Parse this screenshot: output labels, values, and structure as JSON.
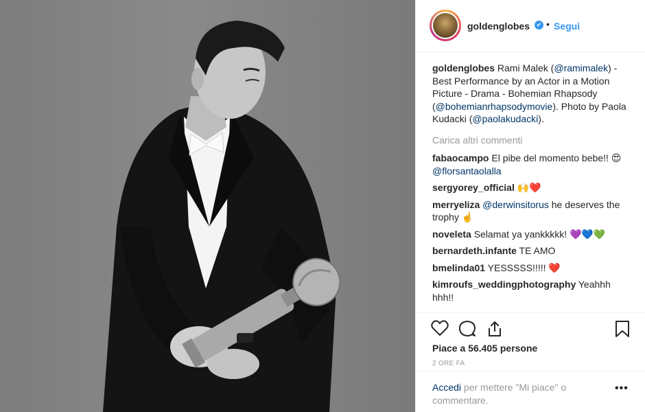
{
  "post": {
    "username": "goldenglobes",
    "verified_badge": "✔",
    "separator": "•",
    "follow_label": "Segui",
    "caption": {
      "author": "goldenglobes",
      "text_1": " Rami Malek (",
      "mention_1": "@ramimalek",
      "text_2": ") - Best Performance by an Actor in a Motion Picture - Drama - Bohemian Rhapsody (",
      "mention_2": "@bohemianrhapsodymovie",
      "text_3": "). Photo by Paola Kudacki (",
      "mention_3": "@paolakudacki",
      "text_4": ")."
    },
    "load_more_label": "Carica altri commenti",
    "comments": [
      {
        "user": "fabaocampo",
        "text": " El pibe del momento bebe!! 😍 ",
        "mention": "@florsantaolalla",
        "after": ""
      },
      {
        "user": "sergyorey_official",
        "text": " 🙌❤️",
        "mention": "",
        "after": ""
      },
      {
        "user": "merryeliza",
        "text": " ",
        "mention": "@derwinsitorus",
        "after": " he deserves the trophy ☝️"
      },
      {
        "user": "noveleta",
        "text": " Selamat ya yankkkkk! 💜💙💚",
        "mention": "",
        "after": ""
      },
      {
        "user": "bernardeth.infante",
        "text": " TE AMO",
        "mention": "",
        "after": ""
      },
      {
        "user": "bmelinda01",
        "text": " YESSSSS!!!!! ❤️",
        "mention": "",
        "after": ""
      },
      {
        "user": "kimroufs_weddingphotography",
        "text": " Yeahhh hhh!!",
        "mention": "",
        "after": ""
      }
    ],
    "likes_text": "Piace a 56.405 persone",
    "time_ago": "2 ORE FA",
    "footer": {
      "login_label": "Accedi",
      "rest_text": " per mettere \"Mi piace\" o commentare.",
      "more_icon": "•••"
    },
    "icons": [
      "heart-icon",
      "comment-icon",
      "share-icon",
      "bookmark-icon",
      "more-options-icon"
    ]
  }
}
